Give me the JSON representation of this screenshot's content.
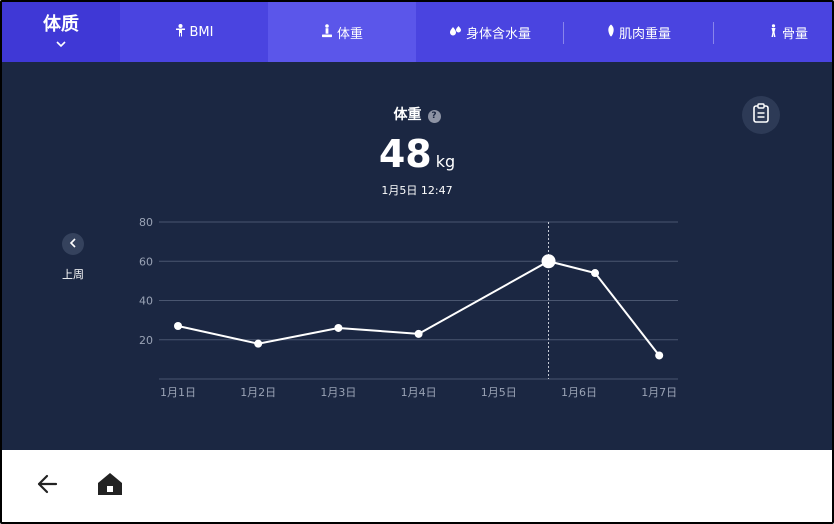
{
  "header": {
    "section_title": "体质",
    "tabs": [
      {
        "label": "BMI",
        "icon": "person-icon",
        "active": false
      },
      {
        "label": "体重",
        "icon": "scale-person-icon",
        "active": true
      },
      {
        "label": "身体含水量",
        "icon": "water-drops-icon",
        "active": false
      },
      {
        "label": "肌肉重量",
        "icon": "muscle-icon",
        "active": false
      },
      {
        "label": "骨量",
        "icon": "bone-person-icon",
        "active": false
      }
    ]
  },
  "metric": {
    "title": "体重",
    "value": "48",
    "unit": "kg",
    "timestamp": "1月5日  12:47"
  },
  "nav": {
    "prev_label": "上周"
  },
  "colors": {
    "tab_bar": "#4a44e0",
    "tab_active": "#5b56ea",
    "panel": "#1b2742",
    "line": "#ffffff"
  },
  "chart_data": {
    "type": "line",
    "categories": [
      "1月1日",
      "1月2日",
      "1月3日",
      "1月4日",
      "1月5日",
      "1月6日",
      "1月7日"
    ],
    "ylim": [
      0,
      80
    ],
    "yticks": [
      20,
      40,
      60,
      80
    ],
    "grid": true,
    "series": [
      {
        "points": [
          {
            "x": 0.0,
            "y": 27
          },
          {
            "x": 1.0,
            "y": 18
          },
          {
            "x": 2.0,
            "y": 26
          },
          {
            "x": 3.0,
            "y": 23
          },
          {
            "x": 4.62,
            "y": 60
          },
          {
            "x": 5.2,
            "y": 54
          },
          {
            "x": 6.0,
            "y": 12
          }
        ]
      }
    ],
    "highlight_index": 4
  }
}
